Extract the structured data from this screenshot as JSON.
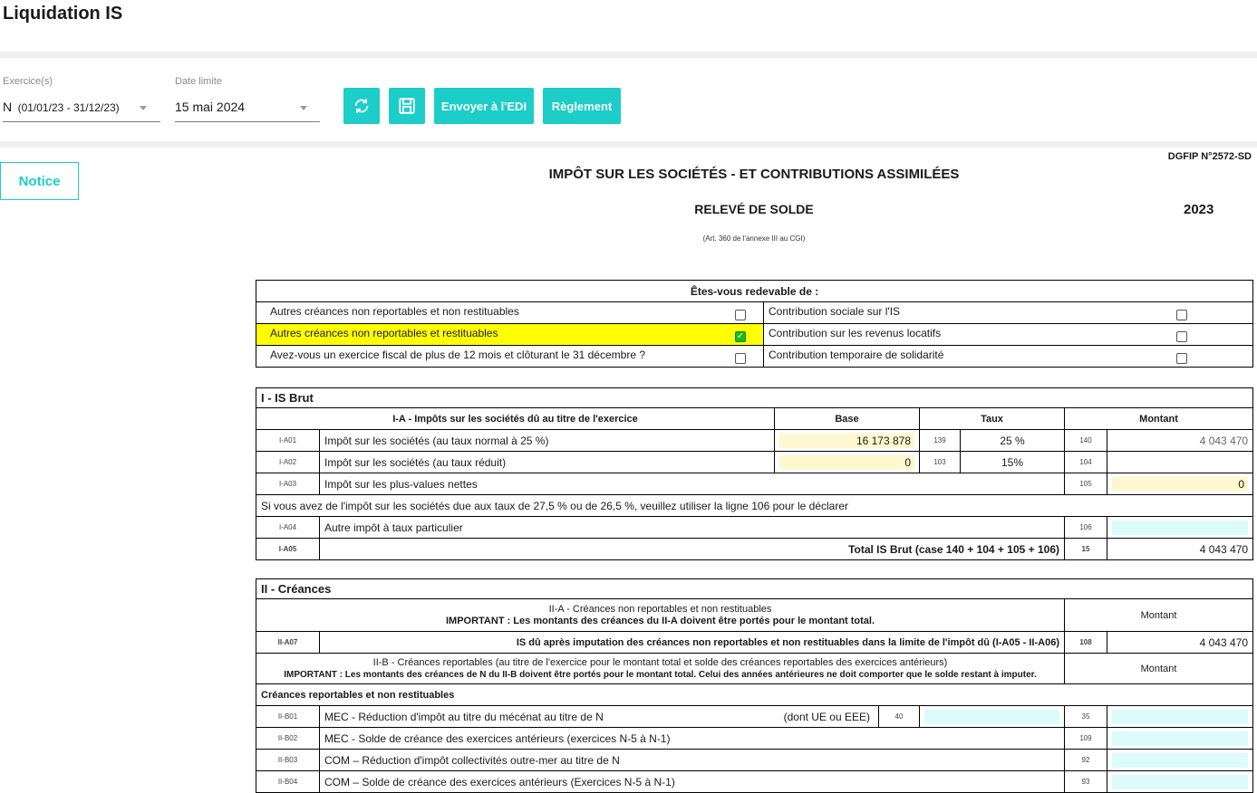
{
  "page": {
    "title": "Liquidation IS"
  },
  "toolbar": {
    "exercise_label": "Exercice(s)",
    "exercise_prefix": "N",
    "exercise_value": "(01/01/23 - 31/12/23)",
    "deadline_label": "Date limite",
    "deadline_value": "15 mai 2024",
    "refresh_icon": "refresh-icon",
    "save_icon": "save-icon",
    "edi_label": "Envoyer à l'EDI",
    "payment_label": "Règlement",
    "accent": "#1ccdc8"
  },
  "notice": {
    "label": "Notice"
  },
  "form": {
    "ref": "DGFIP N°2572-SD",
    "title": "IMPÔT SUR LES SOCIÉTÉS - ET CONTRIBUTIONS ASSIMILÉES",
    "subtitle": "RELEVÉ DE SOLDE",
    "year": "2023",
    "legal": "(Art. 360 de l'annexe III au CGI)"
  },
  "redevable": {
    "heading": "Êtes-vous redevable de :",
    "rows": [
      {
        "left": "Autres créances non reportables et non restituables",
        "left_checked": false,
        "right": "Contribution sociale sur l'IS",
        "right_checked": false
      },
      {
        "left": "Autres créances non reportables et restituables",
        "left_checked": true,
        "right": "Contribution sur les revenus locatifs",
        "right_checked": false
      },
      {
        "left": "Avez-vous un exercice fiscal de plus de 12 mois et clôturant le 31 décembre ?",
        "left_checked": false,
        "right": "Contribution temporaire de solidarité",
        "right_checked": false
      }
    ],
    "highlight_color": "#ffff00"
  },
  "is_brut": {
    "title": "I - IS Brut",
    "col_desc": "I-A - Impôts sur les sociétés dû au titre de l'exercice",
    "col_base": "Base",
    "col_taux": "Taux",
    "col_montant": "Montant",
    "r1": {
      "code": "I-A01",
      "label": "Impôt sur les sociétés (au taux normal à 25 %)",
      "base": "16 173 878",
      "case_taux": "139",
      "taux": "25 %",
      "case_montant": "140",
      "montant": "4 043 470"
    },
    "r2": {
      "code": "I-A02",
      "label": "Impôt sur les sociétés (au taux réduit)",
      "base": "0",
      "case_taux": "103",
      "taux": "15%",
      "case_montant": "104",
      "montant": ""
    },
    "r3": {
      "code": "I-A03",
      "label": "Impôt sur les plus-values nettes",
      "case_montant": "105",
      "montant": "0"
    },
    "note": "Si vous avez de l'impôt sur les sociétés due aux taux de 27,5 % ou de 26,5 %, veuillez utiliser la ligne 106 pour le déclarer",
    "r4": {
      "code": "I-A04",
      "label": "Autre impôt à taux particulier",
      "case_montant": "106",
      "montant": ""
    },
    "r5": {
      "code": "I-A05",
      "label": "Total IS Brut (case 140 + 104 + 105 + 106)",
      "case_montant": "15",
      "montant": "4 043 470"
    }
  },
  "creances": {
    "title": "II - Créances",
    "a_line1": "II-A - Créances non reportables et non restituables",
    "a_line2": "IMPORTANT : Les montants des créances du II-A doivent être portés pour le montant total.",
    "col_montant": "Montant",
    "a07": {
      "code": "II-A07",
      "label": "IS dû après imputation des créances non reportables et non restituables dans la limite de l'impôt dû (I-A05 - II-A06)",
      "case": "108",
      "montant": "4 043 470"
    },
    "b_line1": "II-B - Créances reportables (au titre de l'exercice pour le montant total et solde des créances reportables des exercices antérieurs)",
    "b_line2": "IMPORTANT : Les montants des créances de N du II-B doivent être portés pour le montant total. Celui des années antérieures ne doit comporter que le solde restant à imputer.",
    "sub_heading": "Créances reportables et non restituables",
    "b01": {
      "code": "II-B01",
      "label": "MEC - Réduction d'impôt au titre du mécénat au titre de N",
      "dont_label": "(dont UE ou EEE)",
      "dont_case": "40",
      "case": "35",
      "montant": ""
    },
    "b02": {
      "code": "II-B02",
      "label": "MEC - Solde de créance des exercices antérieurs (exercices N-5 à N-1)",
      "case": "109",
      "montant": ""
    },
    "b03": {
      "code": "II-B03",
      "label": "COM – Réduction d'impôt collectivités outre-mer au titre de N",
      "case": "92",
      "montant": ""
    },
    "b04": {
      "code": "II-B04",
      "label": "COM – Solde de créance des exercices antérieurs (Exercices N-5 à N-1)",
      "case": "93",
      "montant": ""
    }
  }
}
